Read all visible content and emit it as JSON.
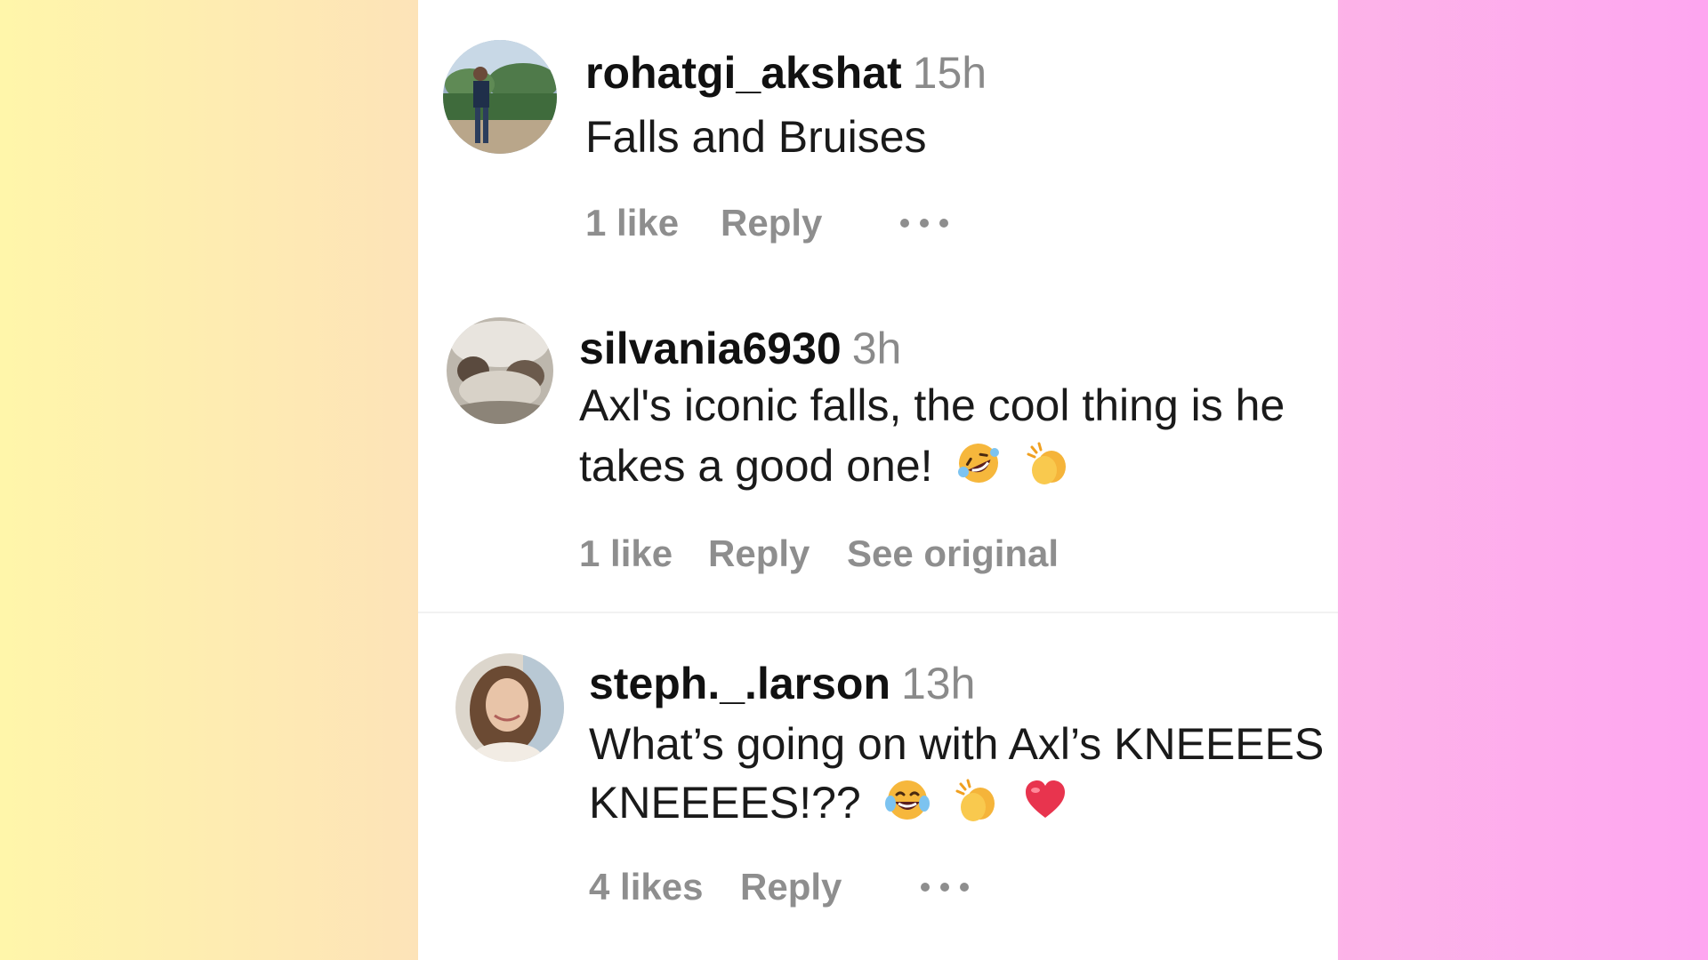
{
  "comments": [
    {
      "username": "rohatgi_akshat",
      "time": "15h",
      "text_lines": [
        "Falls and Bruises"
      ],
      "likes": "1 like",
      "reply": "Reply",
      "extra_action": ""
    },
    {
      "username": "silvania6930",
      "time": "3h",
      "text_lines": [
        "Axl's iconic falls, the cool thing is he",
        "takes a good one!"
      ],
      "likes": "1 like",
      "reply": "Reply",
      "extra_action": "See original"
    },
    {
      "username": "steph._.larson",
      "time": "13h",
      "text_lines": [
        "What’s going on with Axl’s KNEEEES",
        "KNEEEES!??"
      ],
      "likes": "4 likes",
      "reply": "Reply",
      "extra_action": ""
    }
  ],
  "emojis": {
    "comment_2": [
      "rolling-on-floor-laughing-emoji",
      "clapping-hands-emoji"
    ],
    "comment_3": [
      "tears-of-joy-emoji",
      "clapping-hands-emoji",
      "red-heart-emoji"
    ]
  },
  "icons": {
    "more_options": "more-options-icon"
  },
  "colors": {
    "username": "#111111",
    "meta": "#8e8e8e",
    "gradient_left": "#fff6aa",
    "gradient_right": "#fea6f0"
  }
}
